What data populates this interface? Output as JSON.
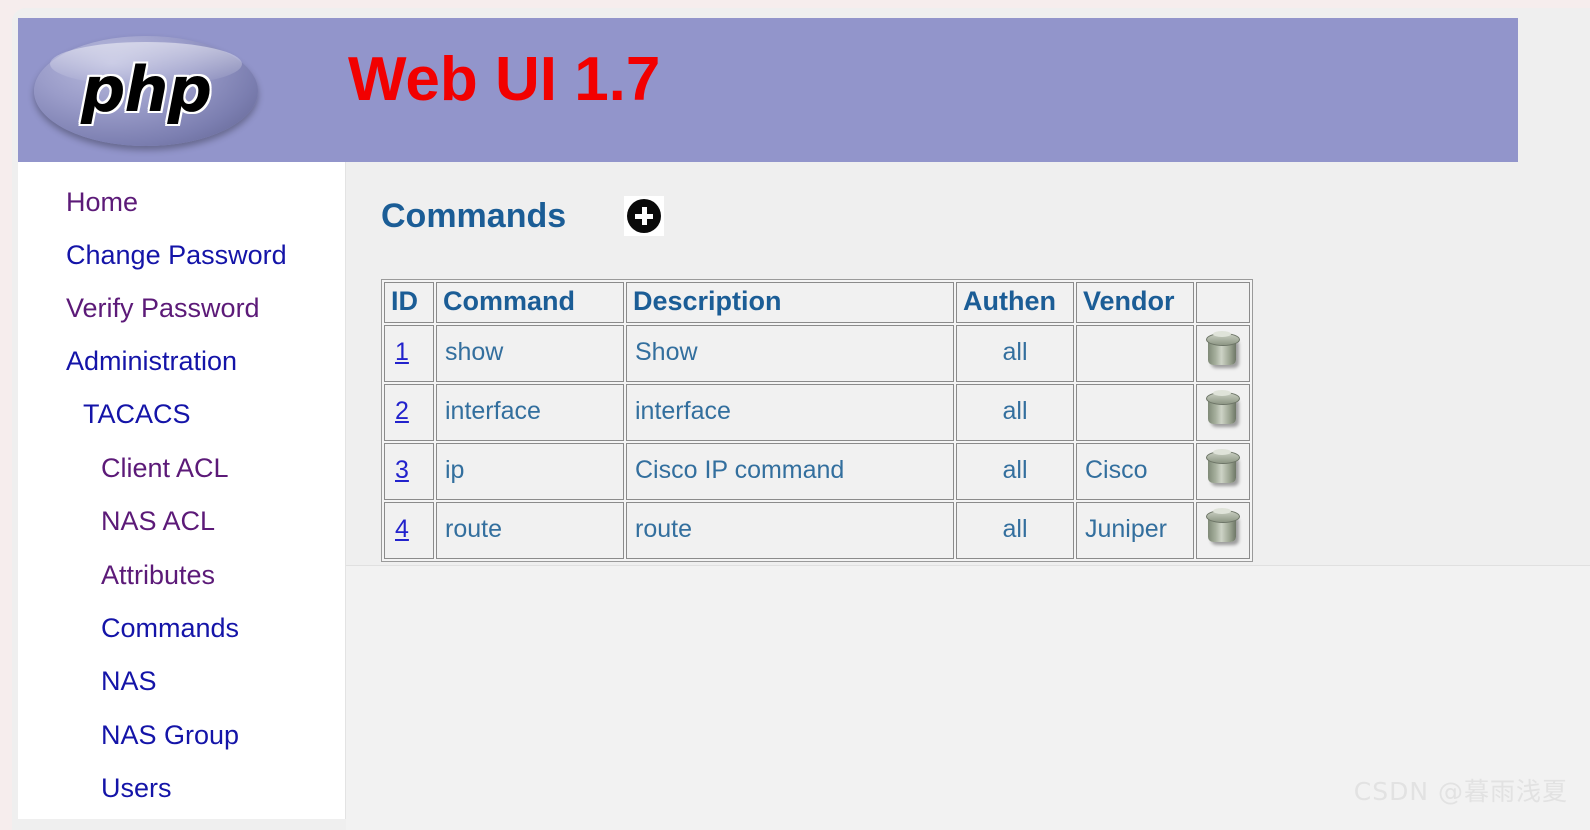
{
  "banner": {
    "logo_text": "php",
    "logo_alt": "php-logo",
    "title": "Web UI 1.7"
  },
  "sidebar": {
    "items": [
      {
        "label": "Home",
        "level": 0,
        "state": "visited"
      },
      {
        "label": "Change Password",
        "level": 0,
        "state": "unvisited"
      },
      {
        "label": "Verify Password",
        "level": 0,
        "state": "visited"
      },
      {
        "label": "Administration",
        "level": 0,
        "state": "unvisited"
      },
      {
        "label": "TACACS",
        "level": 1,
        "state": "unvisited"
      },
      {
        "label": "Client ACL",
        "level": 2,
        "state": "visited"
      },
      {
        "label": "NAS ACL",
        "level": 2,
        "state": "visited"
      },
      {
        "label": "Attributes",
        "level": 2,
        "state": "visited"
      },
      {
        "label": "Commands",
        "level": 2,
        "state": "unvisited"
      },
      {
        "label": "NAS",
        "level": 2,
        "state": "unvisited"
      },
      {
        "label": "NAS Group",
        "level": 2,
        "state": "unvisited"
      },
      {
        "label": "Users",
        "level": 2,
        "state": "unvisited"
      }
    ]
  },
  "main": {
    "title": "Commands",
    "add_button_icon": "plus-circle-icon",
    "table": {
      "columns": [
        "ID",
        "Command",
        "Description",
        "Authen",
        "Vendor",
        ""
      ],
      "rows": [
        {
          "id": "1",
          "command": "show",
          "description": "Show",
          "authen": "all",
          "vendor": "",
          "action_icon": "delete-icon"
        },
        {
          "id": "2",
          "command": "interface",
          "description": "interface",
          "authen": "all",
          "vendor": "",
          "action_icon": "delete-icon"
        },
        {
          "id": "3",
          "command": "ip",
          "description": "Cisco IP command",
          "authen": "all",
          "vendor": "Cisco",
          "action_icon": "delete-icon"
        },
        {
          "id": "4",
          "command": "route",
          "description": "route",
          "authen": "all",
          "vendor": "Juniper",
          "action_icon": "delete-icon"
        }
      ]
    }
  },
  "watermark": {
    "text": "CSDN @暮雨浅夏"
  },
  "colors": {
    "banner_bg": "#9295cb",
    "banner_title": "#f20000",
    "heading": "#1b5d96",
    "link_visited": "#5c1a78",
    "link_unvisited": "#1414a8",
    "table_text": "#336f9e",
    "id_link": "#2222cc",
    "page_bg": "#f6eded",
    "content_bg": "#efefef"
  }
}
